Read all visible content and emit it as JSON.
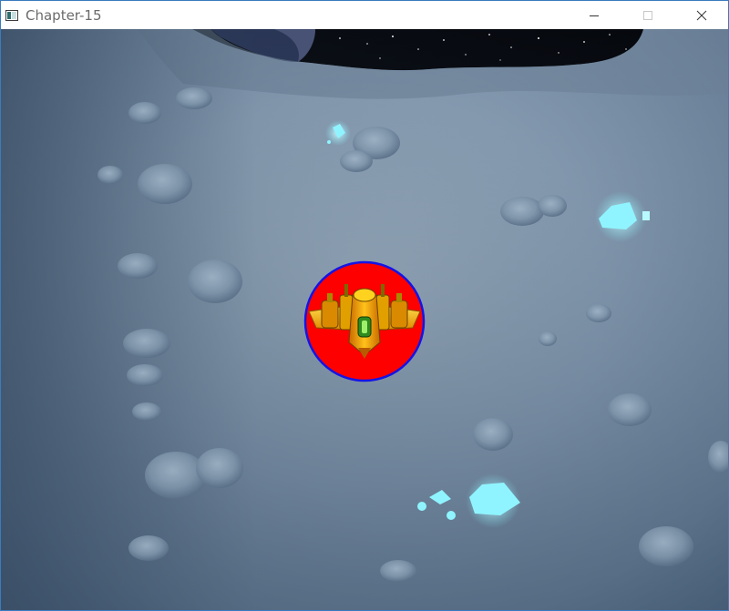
{
  "window": {
    "title": "Chapter-15",
    "icon": "app-window-icon",
    "controls": {
      "minimize_icon": "minimize-icon",
      "maximize_icon": "maximize-icon",
      "close_icon": "close-icon"
    }
  },
  "scene": {
    "background": "moon-surface-with-craters",
    "sky": "starfield",
    "player": {
      "sprite": "yellow-spaceship",
      "hitbox_fill": "#ff0000",
      "hitbox_stroke": "#1414e6"
    },
    "crystal_color": "#7ff0ff"
  }
}
